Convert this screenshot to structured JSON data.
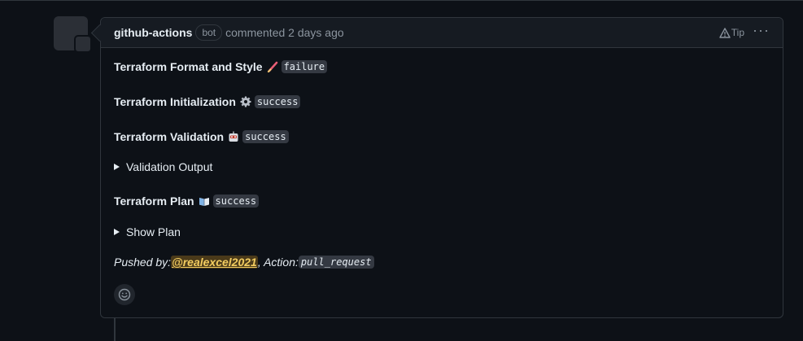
{
  "comment": {
    "author": "github-actions",
    "bot_badge": "bot",
    "meta": "commented 2 days ago",
    "tip_label": "Tip",
    "more_label": "···"
  },
  "body": {
    "format": {
      "title": "Terraform Format and Style",
      "emoji": "paintbrush-icon",
      "status": "failure"
    },
    "init": {
      "title": "Terraform Initialization",
      "emoji": "gear-icon",
      "status": "success"
    },
    "validate": {
      "title": "Terraform Validation",
      "emoji": "robot-icon",
      "status": "success"
    },
    "validation_output": "Validation Output",
    "plan": {
      "title": "Terraform Plan",
      "emoji": "open-book-icon",
      "status": "success"
    },
    "show_plan": "Show Plan",
    "pushed_prefix": "Pushed by: ",
    "pushed_user": "@realexcel2021",
    "action_prefix": ", Action: ",
    "action": "pull_request"
  },
  "colors": {
    "background": "#0d1117",
    "header": "#161b22",
    "border": "#30363d",
    "muted": "#8b949e",
    "mention_bg": "#4a3a1a",
    "mention_fg": "#f2cc60"
  }
}
